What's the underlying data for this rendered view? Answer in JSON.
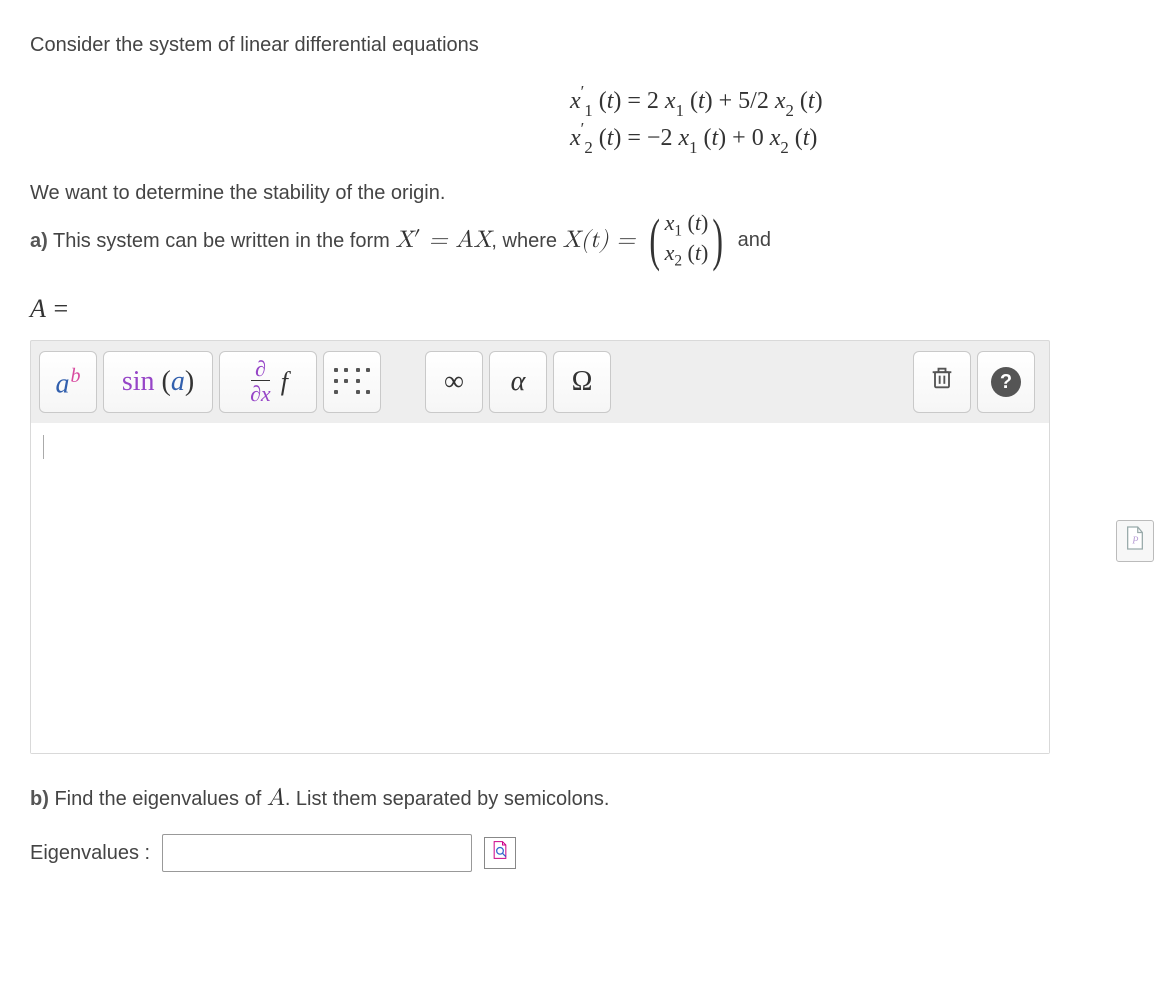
{
  "intro": "Consider the system of linear differential equations",
  "equations": {
    "row1": "x′₁ (t) = 2 x₁ (t) + 5/2 x₂ (t)",
    "row2": "x′₂ (t) = −2 x₁ (t) + 0 x₂ (t)"
  },
  "line2": "We want to determine the stability of the origin.",
  "part_a": {
    "label": "a)",
    "pre": " This system can be written in the form ",
    "form_math": "X′ = AX",
    "mid": ", where ",
    "where_math": "X(t) =",
    "vector_top": "x₁ (t)",
    "vector_bot": "x₂ (t)",
    "tail": " and",
    "A_eq": "A ="
  },
  "toolbar": {
    "exp_a": "a",
    "exp_b": "b",
    "sin": "sin",
    "sin_arg": "a",
    "deriv_top": "∂",
    "deriv_bot": "∂x",
    "deriv_f": "f",
    "infinity": "∞",
    "alpha": "α",
    "omega": "Ω"
  },
  "part_b": {
    "label": "b)",
    "text": " Find the eigenvalues of ",
    "A_sym": "A",
    "text2": ". List them separated by semicolons.",
    "eigen_label": "Eigenvalues :",
    "eigen_value": ""
  }
}
